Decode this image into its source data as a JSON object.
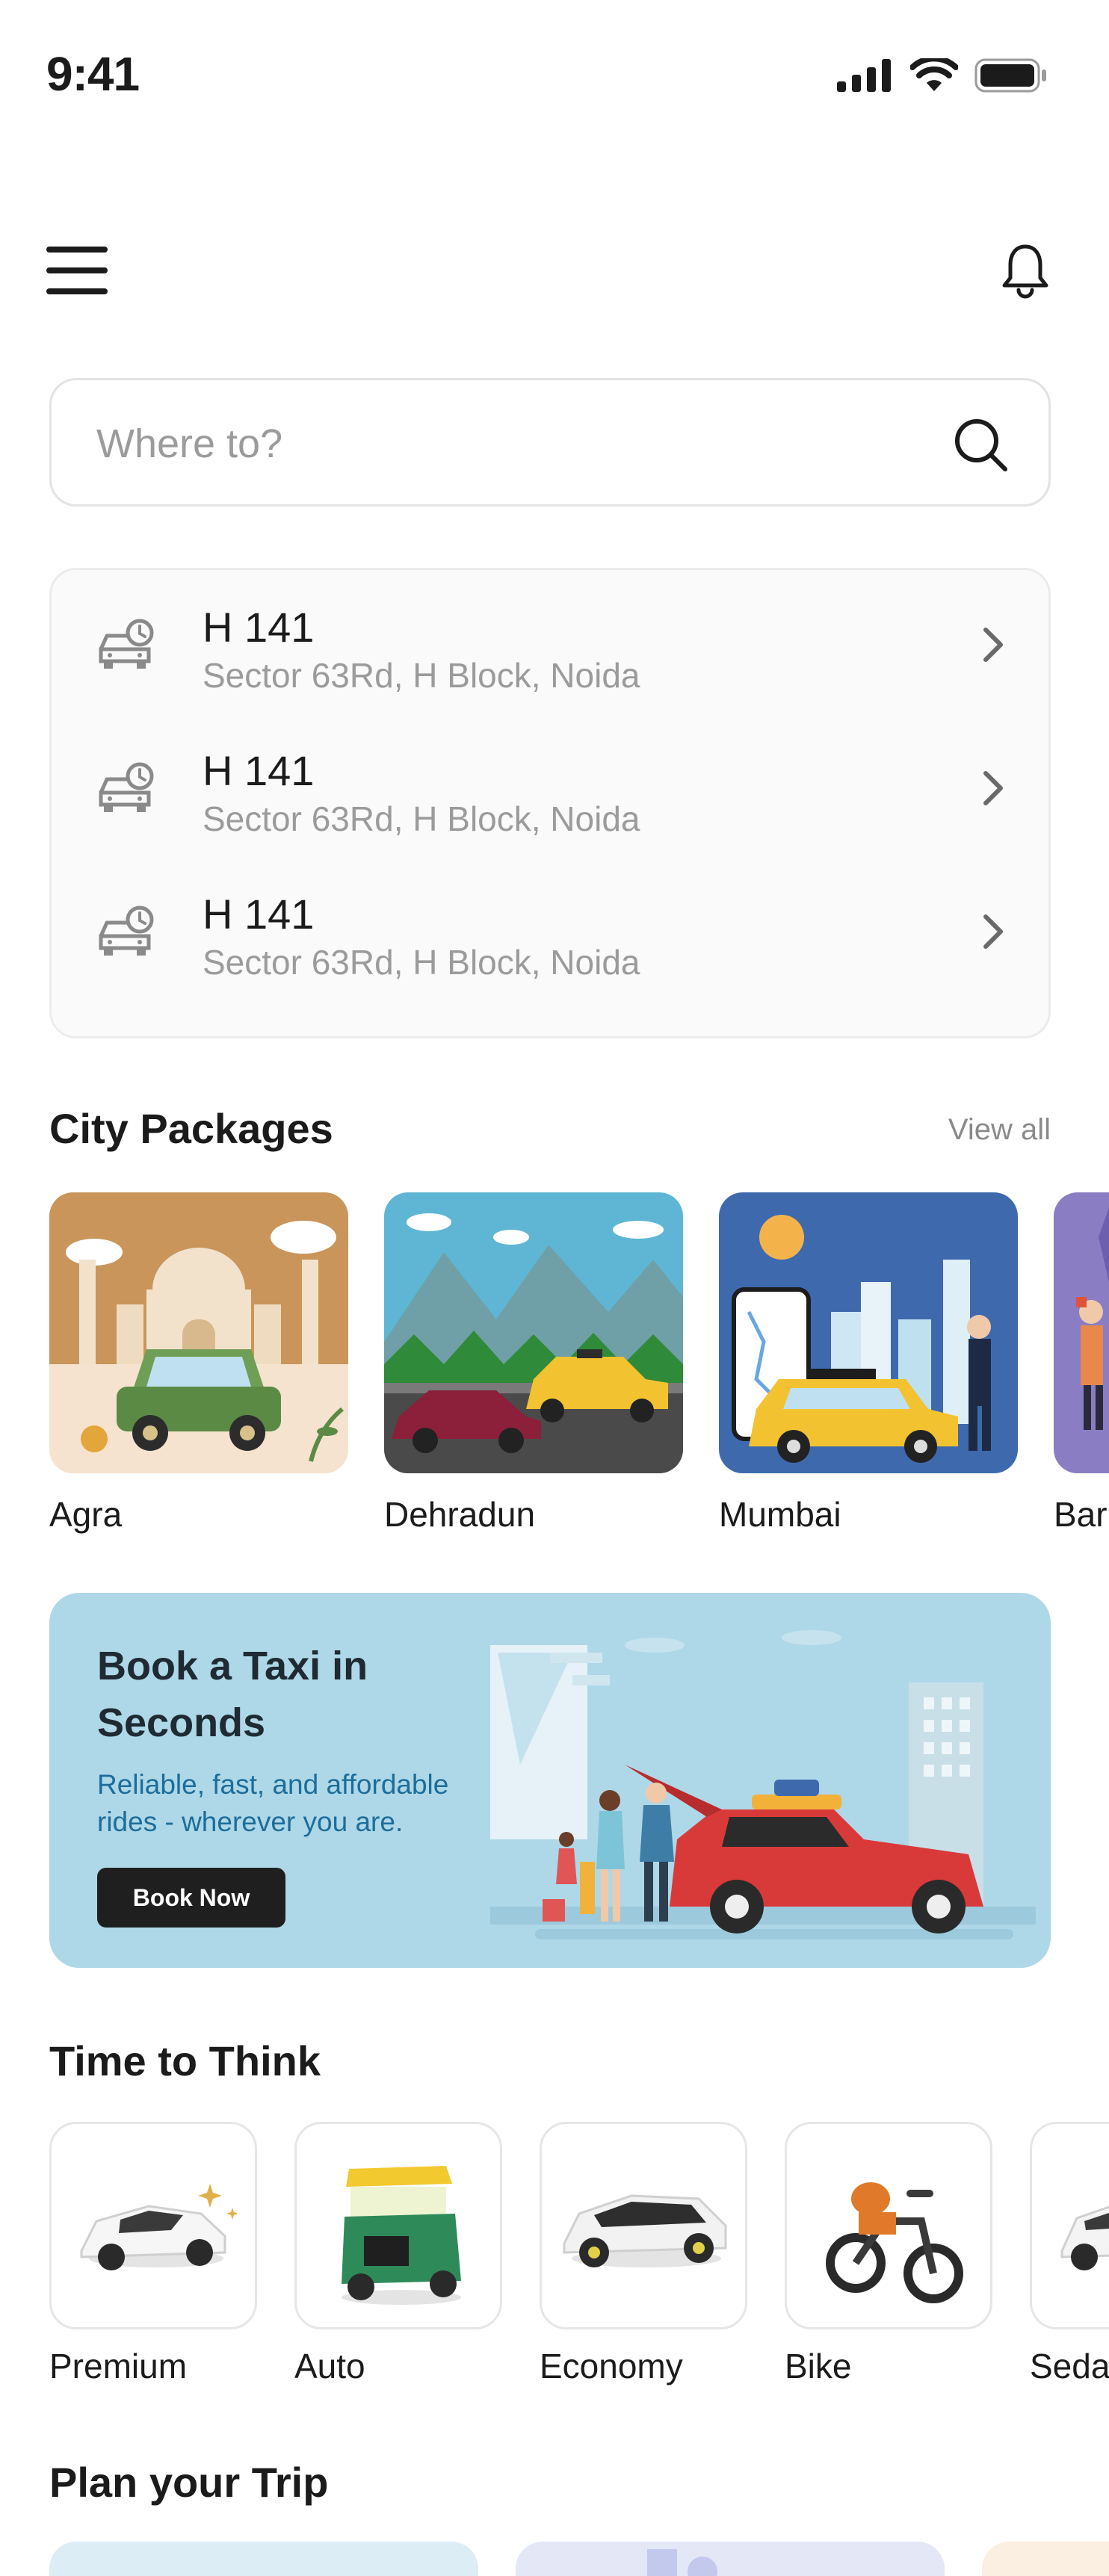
{
  "status_bar": {
    "time": "9:41"
  },
  "search": {
    "placeholder": "Where to?"
  },
  "recent_locations": [
    {
      "title": "H 141",
      "address": "Sector 63Rd, H Block, Noida"
    },
    {
      "title": "H 141",
      "address": "Sector 63Rd, H Block, Noida"
    },
    {
      "title": "H 141",
      "address": "Sector 63Rd, H Block, Noida"
    }
  ],
  "city_packages": {
    "title": "City Packages",
    "view_all": "View all",
    "items": [
      {
        "label": "Agra"
      },
      {
        "label": "Dehradun"
      },
      {
        "label": "Mumbai"
      },
      {
        "label": "Bar"
      }
    ]
  },
  "banner": {
    "title": "Book a Taxi in Seconds",
    "subtitle": "Reliable, fast, and affordable rides - wherever you are.",
    "button": "Book Now"
  },
  "time_to_think": {
    "title": "Time to Think",
    "items": [
      {
        "label": "Premium"
      },
      {
        "label": "Auto"
      },
      {
        "label": "Economy"
      },
      {
        "label": "Bike"
      },
      {
        "label": "Seda"
      }
    ]
  },
  "plan_trip": {
    "title": "Plan your Trip"
  },
  "colors": {
    "banner_bg": "#aed8e8",
    "banner_text": "#1d6d9a",
    "button_bg": "#1f1f1f"
  }
}
